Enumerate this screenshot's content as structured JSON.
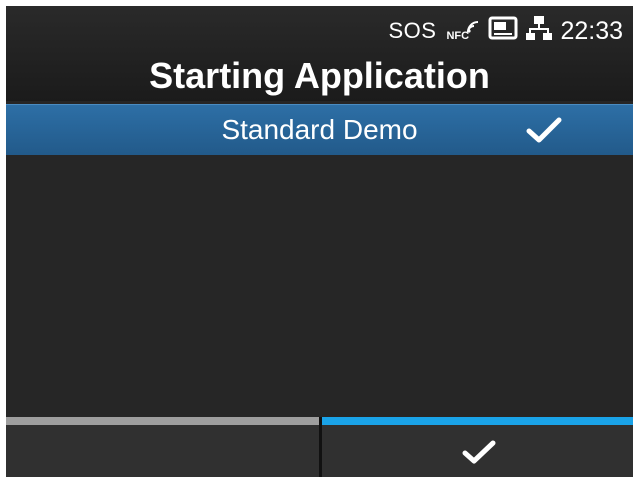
{
  "status_bar": {
    "sos_label": "SOS",
    "nfc_label": "NFC",
    "icons": [
      "nfc-icon",
      "sd-card-icon",
      "network-icon"
    ],
    "time": "22:33"
  },
  "title": "Starting Application",
  "list": {
    "items": [
      {
        "label": "Standard Demo",
        "selected": true,
        "check_icon": "checkmark-icon"
      }
    ]
  },
  "softkeys": {
    "left": {
      "label": "",
      "accent_color": "#9e9e9e"
    },
    "right": {
      "icon": "checkmark-icon",
      "accent_color": "#1aa3e8"
    }
  },
  "colors": {
    "background": "#262626",
    "selection": "#2d6fa6",
    "accent": "#1aa3e8"
  }
}
